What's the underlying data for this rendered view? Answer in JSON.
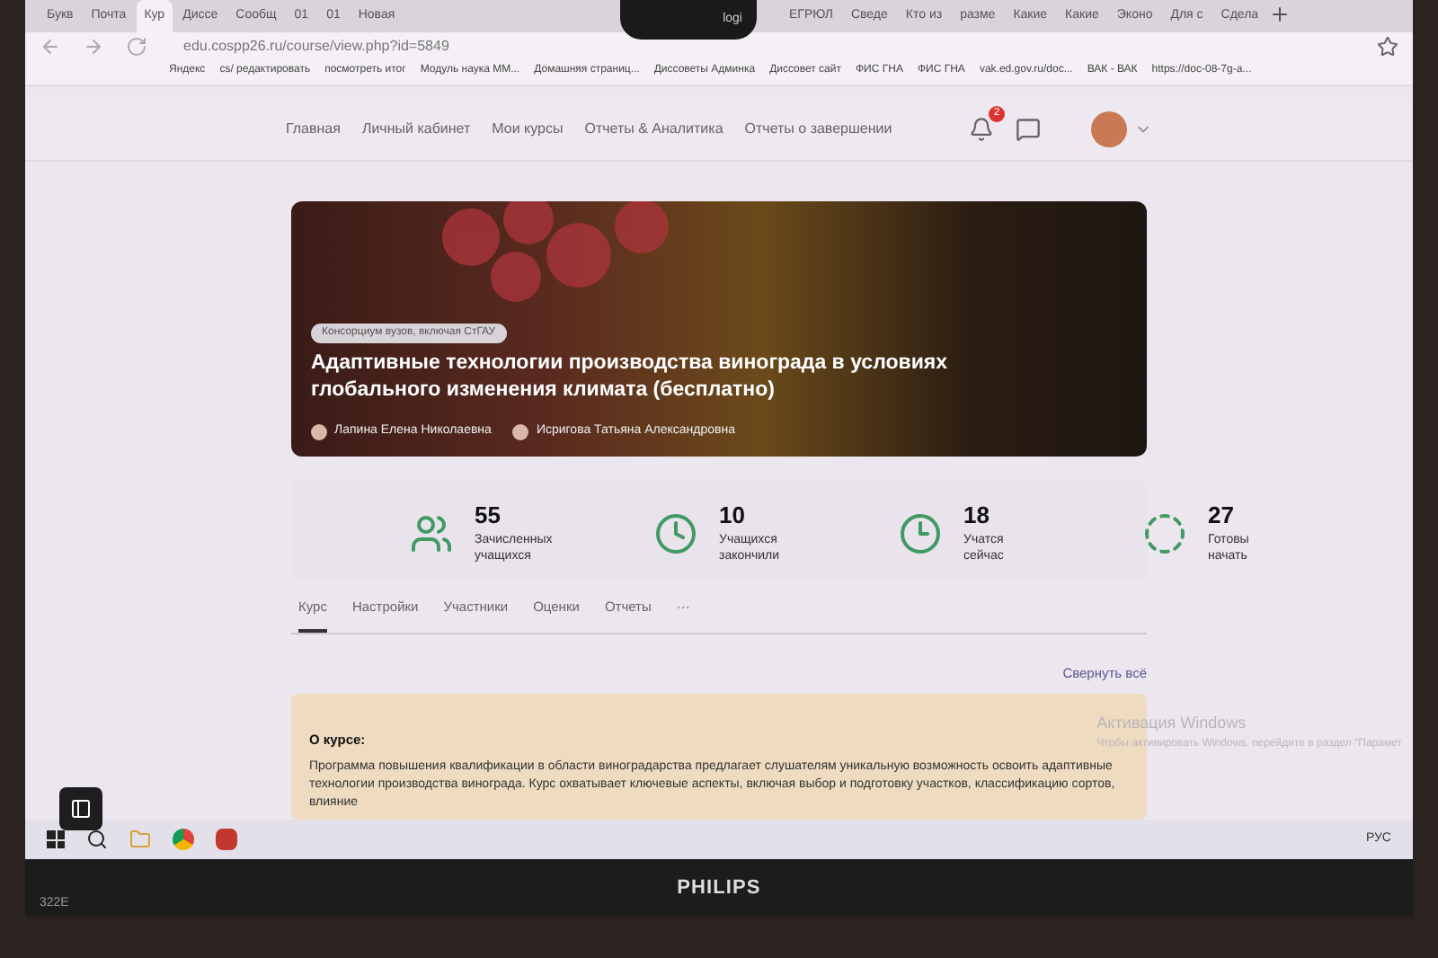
{
  "browser": {
    "tabs": [
      {
        "label": "Букв",
        "selected": false
      },
      {
        "label": "Почта",
        "selected": false
      },
      {
        "label": "Кур",
        "selected": true
      },
      {
        "label": "Диссе",
        "selected": false
      },
      {
        "label": "Сообщ",
        "selected": false
      },
      {
        "label": "01",
        "selected": false
      },
      {
        "label": "01",
        "selected": false
      },
      {
        "label": "Новая",
        "selected": false
      },
      {
        "label": "ЕГРЮЛ",
        "selected": false
      },
      {
        "label": "Сведе",
        "selected": false
      },
      {
        "label": "Кто из",
        "selected": false
      },
      {
        "label": "разме",
        "selected": false
      },
      {
        "label": "Какие",
        "selected": false
      },
      {
        "label": "Какие",
        "selected": false
      },
      {
        "label": "Эконо",
        "selected": false
      },
      {
        "label": "Для с",
        "selected": false
      },
      {
        "label": "Сдела",
        "selected": false
      }
    ],
    "url": "edu.cospp26.ru/course/view.php?id=5849",
    "bookmarks": [
      "Яндекс",
      "cs/ редактировать",
      "посмотреть итог",
      "Модуль наука ММ...",
      "Домашняя страниц...",
      "Диссоветы Админка",
      "Диссовет сайт",
      "ФИС ГНА",
      "ФИС ГНА",
      "vak.ed.gov.ru/doc...",
      "ВАК - ВАК",
      "https://doc-08-7g-a..."
    ]
  },
  "site_nav": {
    "items": [
      "Главная",
      "Личный кабинет",
      "Мои курсы",
      "Отчеты & Аналитика",
      "Отчеты о завершении"
    ],
    "notification_count": "2"
  },
  "course": {
    "tag": "Консорциум вузов, включая СтГАУ",
    "title": "Адаптивные технологии производства винограда в условиях глобального изменения климата (бесплатно)",
    "authors": [
      "Лапина Елена Николаевна",
      "Исригова Татьяна Александровна"
    ]
  },
  "stats": [
    {
      "kind": "enrolled",
      "value": "55",
      "label": "Зачисленных учащихся"
    },
    {
      "kind": "finished",
      "value": "10",
      "label": "Учащихся закончили"
    },
    {
      "kind": "studying",
      "value": "18",
      "label": "Учатся сейчас"
    },
    {
      "kind": "ready",
      "value": "27",
      "label": "Готовы начать"
    }
  ],
  "course_tabs": [
    {
      "label": "Курс",
      "selected": true
    },
    {
      "label": "Настройки",
      "selected": false
    },
    {
      "label": "Участники",
      "selected": false
    },
    {
      "label": "Оценки",
      "selected": false
    },
    {
      "label": "Отчеты",
      "selected": false
    },
    {
      "label": "···",
      "selected": false
    }
  ],
  "collapse_link": "Свернуть всё",
  "about": {
    "heading": "О курсе:",
    "text": "Программа повышения квалификации в области виноградарства предлагает слушателям уникальную возможность освоить адаптивные технологии производства винограда. Курс охватывает ключевые аспекты, включая выбор и подготовку участков, классификацию сортов, влияние"
  },
  "activation": {
    "title": "Активация Windows",
    "hint": "Чтобы активировать Windows, перейдите в раздел \"Парамет"
  },
  "taskbar": {
    "language": "РУС"
  },
  "monitor": {
    "brand": "PHILIPS",
    "model": "322E",
    "webcam_label": "logi"
  }
}
